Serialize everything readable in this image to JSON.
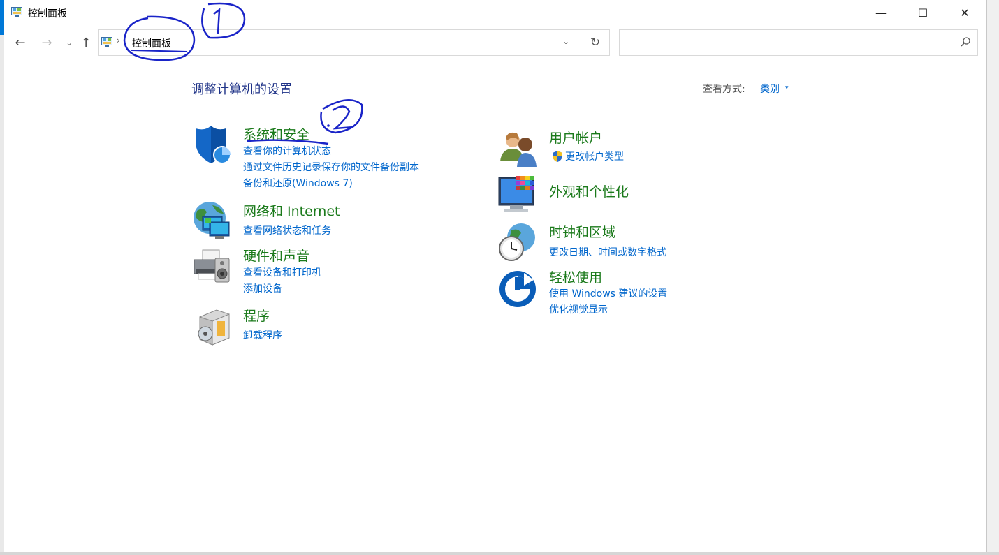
{
  "window": {
    "title": "控制面板",
    "minimize_glyph": "—",
    "maximize_glyph": "☐",
    "close_glyph": "✕"
  },
  "nav": {
    "back_glyph": "←",
    "forward_glyph": "→",
    "recent_glyph": "⌄",
    "up_glyph": "↑",
    "address_separator": "›",
    "breadcrumb": "控制面板",
    "address_dropdown_glyph": "⌄",
    "refresh_glyph": "↻",
    "search_placeholder": ""
  },
  "main": {
    "heading": "调整计算机的设置",
    "view_by_label": "查看方式:",
    "view_by_value": "类别",
    "view_by_caret": "▾"
  },
  "categories_left": [
    {
      "title": "系统和安全",
      "icon": "shield-icon",
      "links": [
        "查看你的计算机状态",
        "通过文件历史记录保存你的文件备份副本",
        "备份和还原(Windows 7)"
      ]
    },
    {
      "title": "网络和 Internet",
      "icon": "network-globe-icon",
      "links": [
        "查看网络状态和任务"
      ]
    },
    {
      "title": "硬件和声音",
      "icon": "printer-speaker-icon",
      "links": [
        "查看设备和打印机",
        "添加设备"
      ]
    },
    {
      "title": "程序",
      "icon": "programs-box-icon",
      "links": [
        "卸载程序"
      ]
    }
  ],
  "categories_right": [
    {
      "title": "用户帐户",
      "icon": "users-icon",
      "links": [
        "更改帐户类型"
      ]
    },
    {
      "title": "外观和个性化",
      "icon": "appearance-monitor-icon",
      "links": []
    },
    {
      "title": "时钟和区域",
      "icon": "clock-globe-icon",
      "links": [
        "更改日期、时间或数字格式"
      ]
    },
    {
      "title": "轻松使用",
      "icon": "ease-of-access-icon",
      "links": [
        "使用 Windows 建议的设置",
        "优化视觉显示"
      ]
    }
  ],
  "colors": {
    "category_title": "#1b7a1b",
    "link": "#0066cc",
    "heading": "#1e3287",
    "annotation_ink": "#1a24c8"
  }
}
